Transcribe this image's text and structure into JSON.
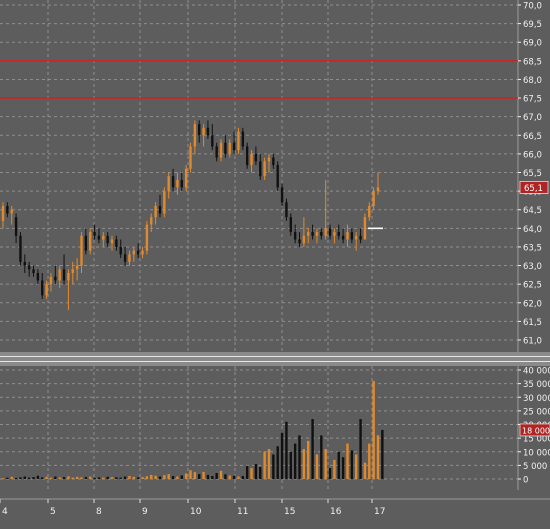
{
  "colors": {
    "background": "#5d5d5d",
    "grid": "#8e8e8e",
    "axis_text": "#f0f0f0",
    "up_candle": "#e08a2c",
    "down_candle": "#111111",
    "level_line": "#d42020",
    "current_price_marker": "#ffffff",
    "price_badge_bg": "#b02424"
  },
  "price_panel": {
    "axis_labels": [
      "70,0",
      "69,5",
      "69,0",
      "68,5",
      "68,0",
      "67,5",
      "67,0",
      "66,5",
      "66,0",
      "65,5",
      "65,0",
      "64,5",
      "64,0",
      "63,5",
      "63,0",
      "62,5",
      "62,0",
      "61,5",
      "61,0"
    ],
    "current_price_badge": "65,1",
    "level_lines": [
      68.5,
      67.5
    ]
  },
  "volume_panel": {
    "axis_labels": [
      "40 000",
      "35 000",
      "30 000",
      "25 000",
      "20 000",
      "15 000",
      "10 000",
      "5 000",
      "0"
    ],
    "current_volume_badge": "18 000"
  },
  "timeline": {
    "labels": [
      "4",
      "5",
      "8",
      "9",
      "10",
      "11",
      "15",
      "16",
      "17"
    ]
  },
  "chart_data": {
    "type": "candlestick",
    "price_axis": {
      "min": 61.0,
      "max": 70.0,
      "step": 0.5
    },
    "volume_axis": {
      "min": 0,
      "max": 40000,
      "step": 5000
    },
    "reference_lines": [
      68.5,
      67.5
    ],
    "last_price": 65.1,
    "candles": [
      {
        "o": 64.2,
        "h": 64.7,
        "l": 64.0,
        "c": 64.6
      },
      {
        "o": 64.6,
        "h": 64.7,
        "l": 64.3,
        "c": 64.4
      },
      {
        "o": 64.4,
        "h": 64.6,
        "l": 64.1,
        "c": 64.5
      },
      {
        "o": 64.3,
        "h": 64.4,
        "l": 63.6,
        "c": 63.8
      },
      {
        "o": 63.8,
        "h": 63.9,
        "l": 63.0,
        "c": 63.1
      },
      {
        "o": 63.1,
        "h": 63.3,
        "l": 62.8,
        "c": 63.0
      },
      {
        "o": 63.0,
        "h": 63.1,
        "l": 62.7,
        "c": 62.9
      },
      {
        "o": 62.9,
        "h": 63.0,
        "l": 62.7,
        "c": 62.8
      },
      {
        "o": 62.8,
        "h": 62.9,
        "l": 62.5,
        "c": 62.6
      },
      {
        "o": 62.6,
        "h": 62.8,
        "l": 62.1,
        "c": 62.2
      },
      {
        "o": 62.2,
        "h": 62.6,
        "l": 62.1,
        "c": 62.5
      },
      {
        "o": 62.5,
        "h": 62.8,
        "l": 62.3,
        "c": 62.7
      },
      {
        "o": 62.7,
        "h": 63.0,
        "l": 62.5,
        "c": 62.6
      },
      {
        "o": 62.6,
        "h": 63.0,
        "l": 62.4,
        "c": 62.9
      },
      {
        "o": 62.9,
        "h": 63.3,
        "l": 62.5,
        "c": 62.6
      },
      {
        "o": 62.6,
        "h": 62.9,
        "l": 61.8,
        "c": 62.8
      },
      {
        "o": 62.8,
        "h": 63.1,
        "l": 62.5,
        "c": 62.9
      },
      {
        "o": 62.9,
        "h": 63.2,
        "l": 62.6,
        "c": 63.0
      },
      {
        "o": 63.0,
        "h": 63.9,
        "l": 62.8,
        "c": 63.8
      },
      {
        "o": 63.8,
        "h": 64.0,
        "l": 63.3,
        "c": 63.4
      },
      {
        "o": 63.4,
        "h": 64.0,
        "l": 63.3,
        "c": 63.9
      },
      {
        "o": 63.9,
        "h": 64.1,
        "l": 63.7,
        "c": 63.8
      },
      {
        "o": 63.8,
        "h": 64.0,
        "l": 63.6,
        "c": 63.7
      },
      {
        "o": 63.7,
        "h": 63.9,
        "l": 63.5,
        "c": 63.8
      },
      {
        "o": 63.8,
        "h": 63.9,
        "l": 63.5,
        "c": 63.6
      },
      {
        "o": 63.6,
        "h": 63.8,
        "l": 63.4,
        "c": 63.7
      },
      {
        "o": 63.7,
        "h": 63.8,
        "l": 63.4,
        "c": 63.5
      },
      {
        "o": 63.5,
        "h": 63.7,
        "l": 63.2,
        "c": 63.3
      },
      {
        "o": 63.3,
        "h": 63.5,
        "l": 63.0,
        "c": 63.1
      },
      {
        "o": 63.1,
        "h": 63.4,
        "l": 63.0,
        "c": 63.3
      },
      {
        "o": 63.3,
        "h": 63.5,
        "l": 63.1,
        "c": 63.4
      },
      {
        "o": 63.4,
        "h": 63.6,
        "l": 63.2,
        "c": 63.3
      },
      {
        "o": 63.3,
        "h": 63.5,
        "l": 63.2,
        "c": 63.4
      },
      {
        "o": 63.4,
        "h": 64.2,
        "l": 63.3,
        "c": 64.1
      },
      {
        "o": 64.1,
        "h": 64.4,
        "l": 63.9,
        "c": 64.3
      },
      {
        "o": 64.3,
        "h": 64.7,
        "l": 64.1,
        "c": 64.6
      },
      {
        "o": 64.6,
        "h": 64.9,
        "l": 64.3,
        "c": 64.4
      },
      {
        "o": 64.4,
        "h": 65.1,
        "l": 64.3,
        "c": 65.0
      },
      {
        "o": 65.0,
        "h": 65.5,
        "l": 64.8,
        "c": 65.4
      },
      {
        "o": 65.4,
        "h": 65.6,
        "l": 65.0,
        "c": 65.1
      },
      {
        "o": 65.1,
        "h": 65.5,
        "l": 64.9,
        "c": 65.3
      },
      {
        "o": 65.3,
        "h": 65.5,
        "l": 65.0,
        "c": 65.1
      },
      {
        "o": 65.1,
        "h": 65.7,
        "l": 65.0,
        "c": 65.6
      },
      {
        "o": 65.6,
        "h": 66.3,
        "l": 65.5,
        "c": 66.2
      },
      {
        "o": 66.2,
        "h": 66.9,
        "l": 66.0,
        "c": 66.8
      },
      {
        "o": 66.8,
        "h": 66.9,
        "l": 66.3,
        "c": 66.5
      },
      {
        "o": 66.5,
        "h": 66.8,
        "l": 66.2,
        "c": 66.7
      },
      {
        "o": 66.7,
        "h": 66.9,
        "l": 66.4,
        "c": 66.5
      },
      {
        "o": 66.5,
        "h": 66.8,
        "l": 66.1,
        "c": 66.2
      },
      {
        "o": 66.2,
        "h": 66.3,
        "l": 65.8,
        "c": 65.9
      },
      {
        "o": 65.9,
        "h": 66.4,
        "l": 65.8,
        "c": 66.3
      },
      {
        "o": 66.3,
        "h": 66.5,
        "l": 65.9,
        "c": 66.0
      },
      {
        "o": 66.0,
        "h": 66.4,
        "l": 65.9,
        "c": 66.3
      },
      {
        "o": 66.3,
        "h": 66.6,
        "l": 66.0,
        "c": 66.1
      },
      {
        "o": 66.1,
        "h": 66.7,
        "l": 66.0,
        "c": 66.6
      },
      {
        "o": 66.6,
        "h": 66.7,
        "l": 66.1,
        "c": 66.2
      },
      {
        "o": 66.2,
        "h": 66.3,
        "l": 65.6,
        "c": 65.7
      },
      {
        "o": 65.7,
        "h": 66.1,
        "l": 65.5,
        "c": 66.0
      },
      {
        "o": 66.0,
        "h": 66.2,
        "l": 65.7,
        "c": 65.8
      },
      {
        "o": 65.8,
        "h": 66.0,
        "l": 65.3,
        "c": 65.4
      },
      {
        "o": 65.4,
        "h": 65.9,
        "l": 65.3,
        "c": 65.8
      },
      {
        "o": 65.8,
        "h": 66.0,
        "l": 65.5,
        "c": 65.9
      },
      {
        "o": 65.9,
        "h": 66.0,
        "l": 65.6,
        "c": 65.7
      },
      {
        "o": 65.7,
        "h": 65.8,
        "l": 65.0,
        "c": 65.1
      },
      {
        "o": 65.1,
        "h": 65.2,
        "l": 64.6,
        "c": 64.7
      },
      {
        "o": 64.7,
        "h": 64.8,
        "l": 64.2,
        "c": 64.3
      },
      {
        "o": 64.3,
        "h": 64.4,
        "l": 63.8,
        "c": 63.9
      },
      {
        "o": 63.9,
        "h": 64.1,
        "l": 63.6,
        "c": 63.7
      },
      {
        "o": 63.7,
        "h": 63.9,
        "l": 63.5,
        "c": 63.6
      },
      {
        "o": 63.6,
        "h": 64.3,
        "l": 63.5,
        "c": 63.8
      },
      {
        "o": 63.8,
        "h": 64.0,
        "l": 63.6,
        "c": 63.9
      },
      {
        "o": 63.9,
        "h": 64.1,
        "l": 63.7,
        "c": 63.8
      },
      {
        "o": 63.8,
        "h": 64.0,
        "l": 63.6,
        "c": 63.9
      },
      {
        "o": 63.9,
        "h": 64.0,
        "l": 63.7,
        "c": 63.8
      },
      {
        "o": 63.8,
        "h": 65.3,
        "l": 63.7,
        "c": 64.0
      },
      {
        "o": 64.0,
        "h": 64.1,
        "l": 63.7,
        "c": 63.8
      },
      {
        "o": 63.8,
        "h": 64.0,
        "l": 63.6,
        "c": 63.9
      },
      {
        "o": 63.9,
        "h": 64.1,
        "l": 63.7,
        "c": 63.8
      },
      {
        "o": 63.8,
        "h": 64.0,
        "l": 63.6,
        "c": 63.7
      },
      {
        "o": 63.7,
        "h": 64.1,
        "l": 63.5,
        "c": 63.9
      },
      {
        "o": 63.9,
        "h": 64.0,
        "l": 63.6,
        "c": 63.7
      },
      {
        "o": 63.7,
        "h": 63.9,
        "l": 63.4,
        "c": 63.8
      },
      {
        "o": 63.8,
        "h": 64.0,
        "l": 63.6,
        "c": 63.7
      },
      {
        "o": 63.7,
        "h": 64.4,
        "l": 63.7,
        "c": 64.3
      },
      {
        "o": 64.3,
        "h": 64.7,
        "l": 64.2,
        "c": 64.6
      },
      {
        "o": 64.6,
        "h": 65.1,
        "l": 64.5,
        "c": 65.0
      },
      {
        "o": 65.0,
        "h": 65.5,
        "l": 64.9,
        "c": 65.1
      }
    ],
    "volumes": [
      300,
      500,
      800,
      400,
      600,
      900,
      500,
      700,
      1200,
      600,
      800,
      500,
      900,
      600,
      700,
      1000,
      500,
      800,
      600,
      700,
      900,
      400,
      600,
      500,
      800,
      700,
      600,
      500,
      900,
      1100,
      800,
      600,
      700,
      1000,
      1500,
      1200,
      900,
      1400,
      1800,
      1100,
      900,
      1300,
      2000,
      3200,
      2500,
      1800,
      2600,
      1500,
      1100,
      2200,
      3000,
      1700,
      1300,
      1200,
      900,
      1100,
      4800,
      4000,
      5500,
      4400,
      10000,
      11000,
      9000,
      12000,
      17000,
      21000,
      10000,
      13000,
      16000,
      11000,
      14000,
      22000,
      9000,
      16000,
      11000,
      4000,
      7000,
      10000,
      8000,
      13000,
      10500,
      9000,
      22000,
      6000,
      13000,
      36000,
      16000,
      18000
    ]
  }
}
